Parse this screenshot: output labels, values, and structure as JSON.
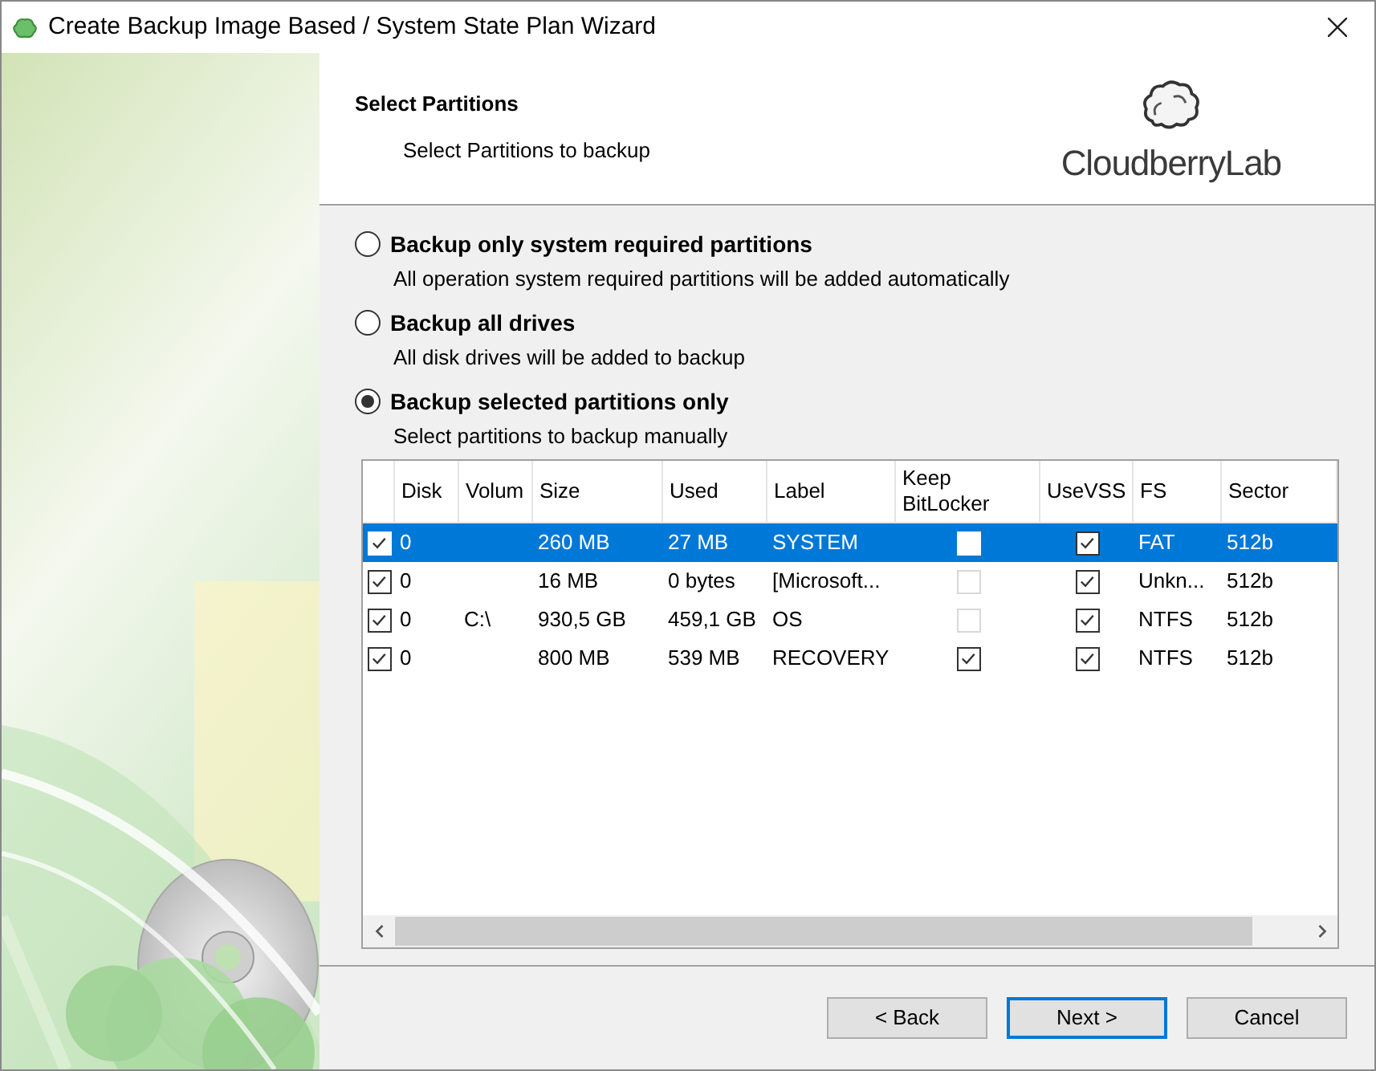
{
  "window": {
    "title": "Create Backup Image Based / System State Plan Wizard"
  },
  "header": {
    "title": "Select Partitions",
    "subtitle": "Select Partitions to backup",
    "logo_text": "CloudberryLab"
  },
  "options": [
    {
      "label": "Backup only system required partitions",
      "description": "All operation system required partitions will be added automatically",
      "selected": false
    },
    {
      "label": "Backup all drives",
      "description": "All disk drives will be added to backup",
      "selected": false
    },
    {
      "label": "Backup selected partitions only",
      "description": "Select partitions to backup manually",
      "selected": true
    }
  ],
  "table": {
    "columns": [
      "Disk",
      "Volum",
      "Size",
      "Used",
      "Label",
      "Keep BitLocker",
      "UseVSS",
      "FS",
      "Sector"
    ],
    "rows": [
      {
        "checked": true,
        "selected": true,
        "disk": "0",
        "volume": "",
        "size": "260 MB",
        "used": "27 MB",
        "label": "SYSTEM",
        "keep_bitlocker": {
          "checked": false,
          "disabled": false
        },
        "use_vss": true,
        "fs": "FAT",
        "sector": "512b"
      },
      {
        "checked": true,
        "selected": false,
        "disk": "0",
        "volume": "",
        "size": "16 MB",
        "used": "0 bytes",
        "label": "[Microsoft...",
        "keep_bitlocker": {
          "checked": false,
          "disabled": true
        },
        "use_vss": true,
        "fs": "Unkn...",
        "sector": "512b"
      },
      {
        "checked": true,
        "selected": false,
        "disk": "0",
        "volume": "C:\\",
        "size": "930,5 GB",
        "used": "459,1 GB",
        "label": "OS",
        "keep_bitlocker": {
          "checked": false,
          "disabled": true
        },
        "use_vss": true,
        "fs": "NTFS",
        "sector": "512b"
      },
      {
        "checked": true,
        "selected": false,
        "disk": "0",
        "volume": "",
        "size": "800 MB",
        "used": "539 MB",
        "label": "RECOVERY",
        "keep_bitlocker": {
          "checked": true,
          "disabled": false
        },
        "use_vss": true,
        "fs": "NTFS",
        "sector": "512b"
      }
    ]
  },
  "buttons": [
    {
      "label": "< Back",
      "default": false
    },
    {
      "label": "Next >",
      "default": true
    },
    {
      "label": "Cancel",
      "default": false
    }
  ]
}
